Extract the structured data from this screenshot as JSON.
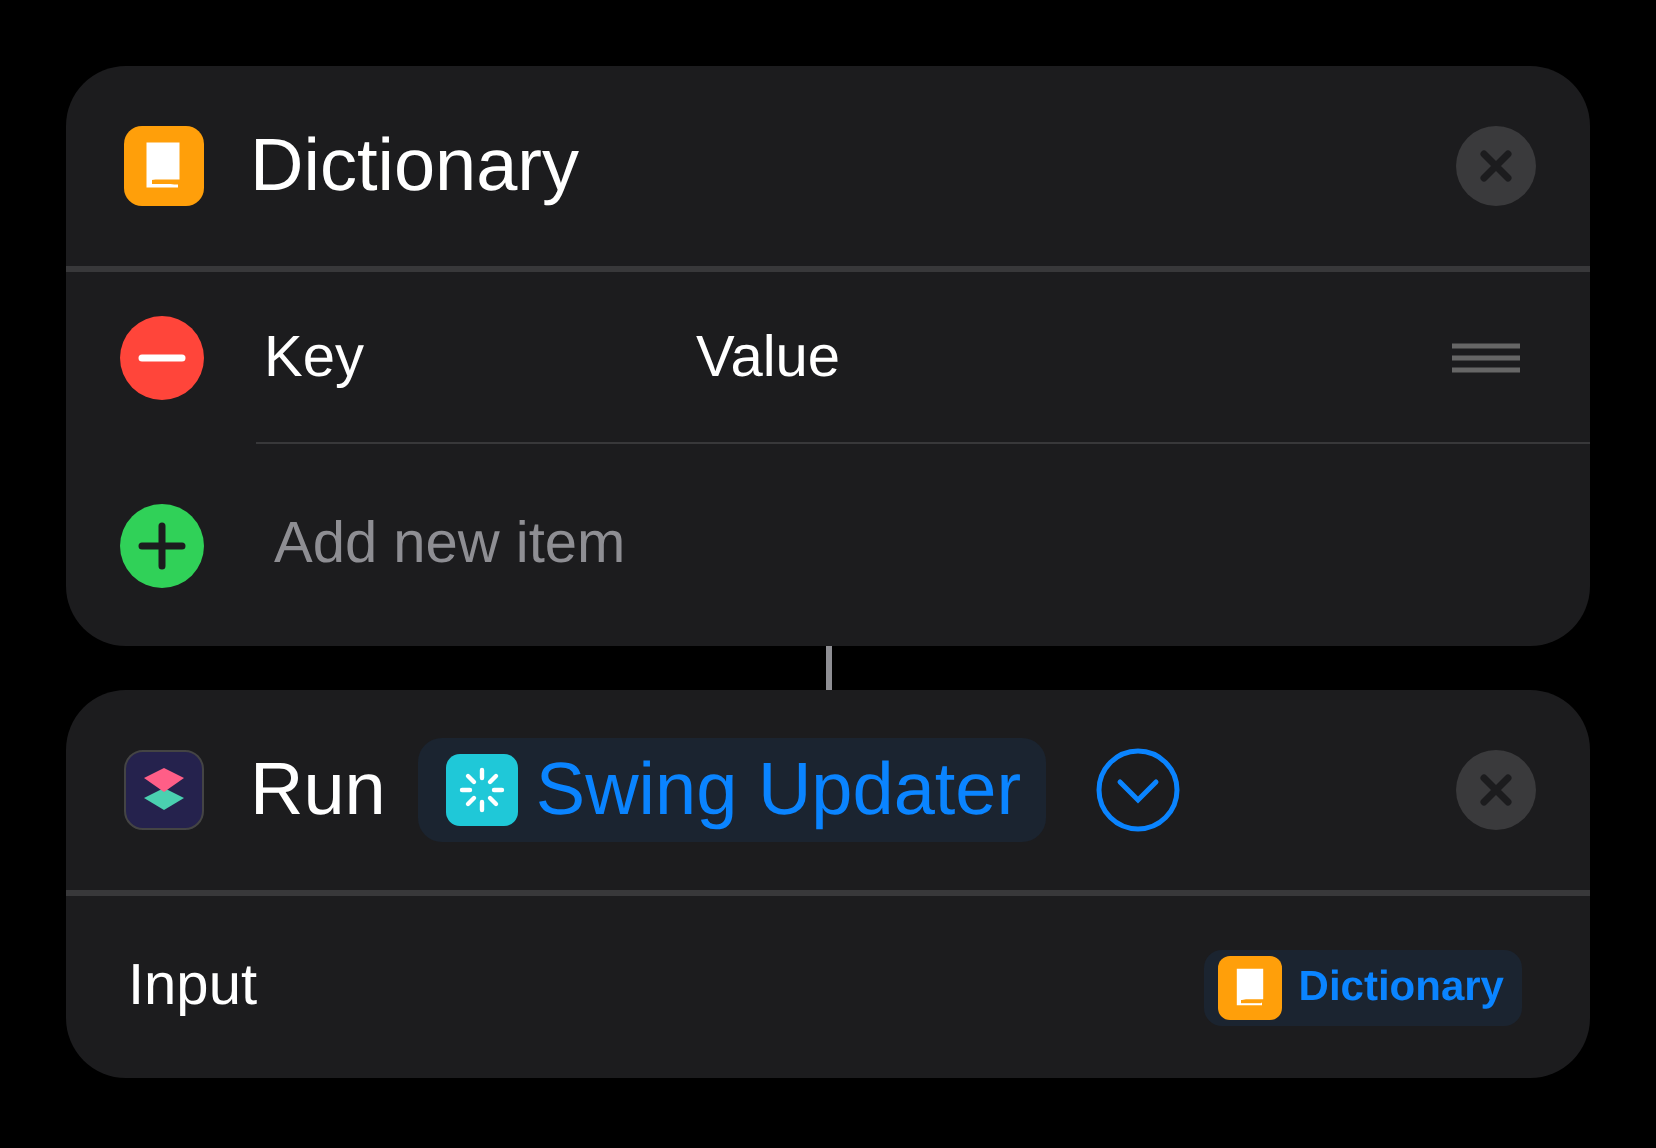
{
  "dictionary_action": {
    "title": "Dictionary",
    "items": [
      {
        "key": "Key",
        "value": "Value"
      }
    ],
    "add_placeholder": "Add new item"
  },
  "run_action": {
    "title": "Run",
    "shortcut": "Swing Updater",
    "expanded": false,
    "input_label": "Input",
    "input_value": "Dictionary"
  }
}
